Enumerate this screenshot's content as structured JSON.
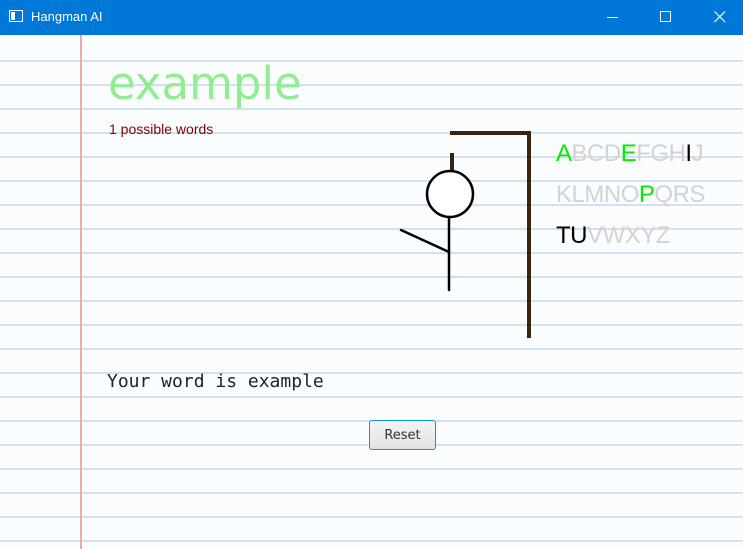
{
  "window": {
    "title": "Hangman AI",
    "accent": "#0078d7"
  },
  "game": {
    "word": "example",
    "possible_words": "1 possible words",
    "message": "Your word is example",
    "reset_label": "Reset",
    "alphabet_rows": [
      [
        {
          "char": "A",
          "state": "correct"
        },
        {
          "char": "B",
          "state": "available"
        },
        {
          "char": "C",
          "state": "available"
        },
        {
          "char": "D",
          "state": "available"
        },
        {
          "char": "E",
          "state": "correct"
        },
        {
          "char": "F",
          "state": "available"
        },
        {
          "char": "G",
          "state": "available"
        },
        {
          "char": "H",
          "state": "available"
        },
        {
          "char": "I",
          "state": "wrong"
        },
        {
          "char": "J",
          "state": "available"
        }
      ],
      [
        {
          "char": "K",
          "state": "available"
        },
        {
          "char": "L",
          "state": "available"
        },
        {
          "char": "M",
          "state": "available"
        },
        {
          "char": "N",
          "state": "available"
        },
        {
          "char": "O",
          "state": "available"
        },
        {
          "char": "P",
          "state": "correct"
        },
        {
          "char": "Q",
          "state": "available"
        },
        {
          "char": "R",
          "state": "available"
        },
        {
          "char": "S",
          "state": "available"
        }
      ],
      [
        {
          "char": "T",
          "state": "wrong"
        },
        {
          "char": "U",
          "state": "wrong"
        },
        {
          "char": "V",
          "state": "available"
        },
        {
          "char": "W",
          "state": "available"
        },
        {
          "char": "X",
          "state": "available"
        },
        {
          "char": "Y",
          "state": "available"
        },
        {
          "char": "Z",
          "state": "available"
        }
      ]
    ]
  },
  "colors": {
    "word": "#90ee90",
    "possible_words": "#800000",
    "correct": "#00ee00",
    "wrong": "#000000",
    "available": "#d3d3d3",
    "paper_lines": "#cfe2f3",
    "margin_line": "#f4a7a7",
    "gallows": "#3a2410"
  }
}
